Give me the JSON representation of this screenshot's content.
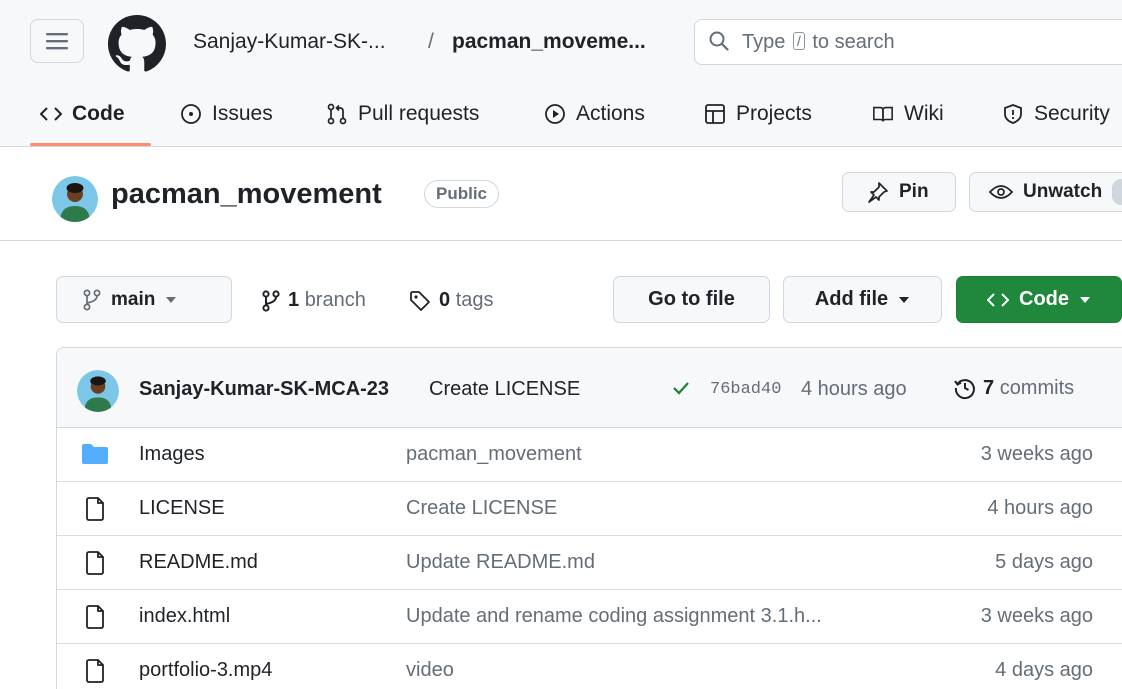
{
  "header": {
    "owner": "Sanjay-Kumar-SK-...",
    "separator": "/",
    "repo": "pacman_moveme...",
    "search_prefix": "Type",
    "search_key": "/",
    "search_suffix": "to search"
  },
  "tabs": [
    {
      "label": "Code",
      "icon": "code-icon",
      "selected": true
    },
    {
      "label": "Issues",
      "icon": "issue-icon"
    },
    {
      "label": "Pull requests",
      "icon": "pull-request-icon"
    },
    {
      "label": "Actions",
      "icon": "play-icon"
    },
    {
      "label": "Projects",
      "icon": "table-icon"
    },
    {
      "label": "Wiki",
      "icon": "book-icon"
    },
    {
      "label": "Security",
      "icon": "shield-icon"
    }
  ],
  "repo": {
    "name": "pacman_movement",
    "visibility": "Public",
    "pin_label": "Pin",
    "unwatch_label": "Unwatch"
  },
  "branch_bar": {
    "branch": "main",
    "branch_count": "1",
    "branch_word": "branch",
    "tag_count": "0",
    "tag_word": "tags",
    "go_to_file": "Go to file",
    "add_file": "Add file",
    "code": "Code"
  },
  "latest_commit": {
    "author": "Sanjay-Kumar-SK-MCA-23",
    "message": "Create LICENSE",
    "sha": "76bad40",
    "time": "4 hours ago",
    "commit_count": "7",
    "commit_word": "commits"
  },
  "files": [
    {
      "type": "folder",
      "name": "Images",
      "message": "pacman_movement",
      "age": "3 weeks ago"
    },
    {
      "type": "file",
      "name": "LICENSE",
      "message": "Create LICENSE",
      "age": "4 hours ago"
    },
    {
      "type": "file",
      "name": "README.md",
      "message": "Update README.md",
      "age": "5 days ago"
    },
    {
      "type": "file",
      "name": "index.html",
      "message": "Update and rename coding assignment 3.1.h...",
      "age": "3 weeks ago"
    },
    {
      "type": "file",
      "name": "portfolio-3.mp4",
      "message": "video",
      "age": "4 days ago"
    }
  ],
  "colors": {
    "accent_green": "#1f883d",
    "tab_underline": "#fd8c73",
    "folder_blue": "#54aeff",
    "check_green": "#1a7f37"
  }
}
